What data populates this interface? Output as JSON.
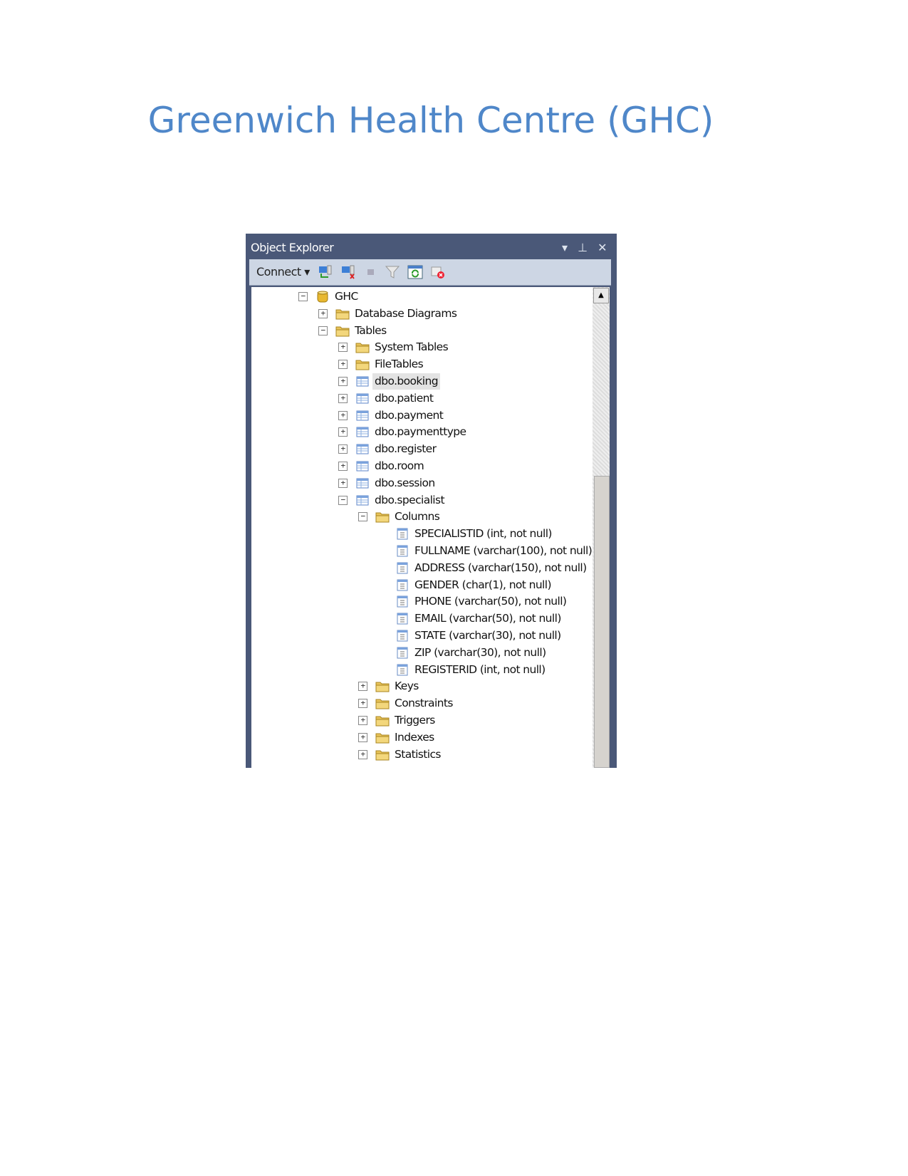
{
  "document": {
    "title": "Greenwich Health Centre (GHC)"
  },
  "panel": {
    "title": "Object Explorer",
    "title_buttons": [
      "dropdown-icon",
      "pin-icon",
      "close-icon"
    ],
    "toolbar": {
      "connect_label": "Connect",
      "icons": [
        "connect-object-explorer-icon",
        "disconnect-icon",
        "stop-icon",
        "filter-icon",
        "refresh-icon",
        "delete-icon"
      ]
    }
  },
  "tree": [
    {
      "label": "GHC",
      "level": 0,
      "icon": "database",
      "toggle": "-"
    },
    {
      "label": "Database Diagrams",
      "level": 1,
      "icon": "folder",
      "toggle": "+"
    },
    {
      "label": "Tables",
      "level": 1,
      "icon": "folder",
      "toggle": "-"
    },
    {
      "label": "System Tables",
      "level": 2,
      "icon": "folder",
      "toggle": "+"
    },
    {
      "label": "FileTables",
      "level": 2,
      "icon": "folder",
      "toggle": "+"
    },
    {
      "label": "dbo.booking",
      "level": 2,
      "icon": "table",
      "toggle": "+",
      "selected": true
    },
    {
      "label": "dbo.patient",
      "level": 2,
      "icon": "table",
      "toggle": "+"
    },
    {
      "label": "dbo.payment",
      "level": 2,
      "icon": "table",
      "toggle": "+"
    },
    {
      "label": "dbo.paymenttype",
      "level": 2,
      "icon": "table",
      "toggle": "+"
    },
    {
      "label": "dbo.register",
      "level": 2,
      "icon": "table",
      "toggle": "+"
    },
    {
      "label": "dbo.room",
      "level": 2,
      "icon": "table",
      "toggle": "+"
    },
    {
      "label": "dbo.session",
      "level": 2,
      "icon": "table",
      "toggle": "+"
    },
    {
      "label": "dbo.specialist",
      "level": 2,
      "icon": "table",
      "toggle": "-"
    },
    {
      "label": "Columns",
      "level": 3,
      "icon": "folder",
      "toggle": "-"
    },
    {
      "label": "SPECIALISTID (int, not null)",
      "level": 4,
      "icon": "column"
    },
    {
      "label": "FULLNAME (varchar(100), not null)",
      "level": 4,
      "icon": "column"
    },
    {
      "label": "ADDRESS (varchar(150), not null)",
      "level": 4,
      "icon": "column"
    },
    {
      "label": "GENDER (char(1), not null)",
      "level": 4,
      "icon": "column"
    },
    {
      "label": "PHONE (varchar(50), not null)",
      "level": 4,
      "icon": "column"
    },
    {
      "label": "EMAIL (varchar(50), not null)",
      "level": 4,
      "icon": "column"
    },
    {
      "label": "STATE (varchar(30), not null)",
      "level": 4,
      "icon": "column"
    },
    {
      "label": "ZIP (varchar(30), not null)",
      "level": 4,
      "icon": "column"
    },
    {
      "label": "REGISTERID (int, not null)",
      "level": 4,
      "icon": "column"
    },
    {
      "label": "Keys",
      "level": 3,
      "icon": "folder",
      "toggle": "+"
    },
    {
      "label": "Constraints",
      "level": 3,
      "icon": "folder",
      "toggle": "+"
    },
    {
      "label": "Triggers",
      "level": 3,
      "icon": "folder",
      "toggle": "+"
    },
    {
      "label": "Indexes",
      "level": 3,
      "icon": "folder",
      "toggle": "+"
    },
    {
      "label": "Statistics",
      "level": 3,
      "icon": "folder",
      "toggle": "+"
    }
  ],
  "colors": {
    "title": "#4f87c9",
    "panel_frame": "#4a5878",
    "toolbar": "#cdd6e4"
  }
}
